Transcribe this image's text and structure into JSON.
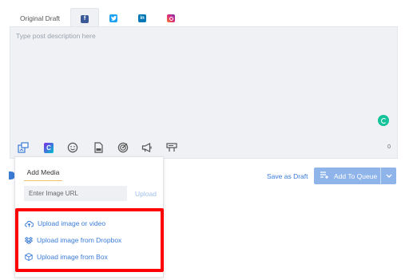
{
  "tabs": [
    {
      "label": "Original Draft",
      "active": false
    },
    {
      "network": "facebook",
      "icon": "facebook-icon",
      "glyph": "f",
      "active": true
    },
    {
      "network": "twitter",
      "icon": "twitter-icon",
      "active": false
    },
    {
      "network": "linkedin",
      "icon": "linkedin-icon",
      "glyph": "in",
      "active": false
    },
    {
      "network": "instagram",
      "icon": "instagram-icon",
      "active": false
    }
  ],
  "editor": {
    "placeholder": "Type post description here",
    "char_count": "0",
    "toolbar_icons": [
      "media-icon",
      "canva-icon",
      "emoji-icon",
      "gif-icon",
      "target-icon",
      "megaphone-icon",
      "caption-icon"
    ],
    "canva_glyph": "C"
  },
  "actions": {
    "save_draft": "Save as Draft",
    "add_to_queue": "Add To Queue"
  },
  "media_popup": {
    "tab_label": "Add Media",
    "url_placeholder": "Enter Image URL",
    "upload_label": "Upload",
    "options": [
      {
        "label": "Upload image or video",
        "icon": "cloud-upload-icon"
      },
      {
        "label": "Upload image from Dropbox",
        "icon": "dropbox-icon"
      },
      {
        "label": "Upload image from Box",
        "icon": "box-icon"
      }
    ]
  },
  "colors": {
    "accent": "#3a7bd5",
    "queue_button": "#8fb4e9",
    "highlight": "#ff0000",
    "editor_bg": "#eff1f4",
    "grammarly": "#15c39a"
  }
}
